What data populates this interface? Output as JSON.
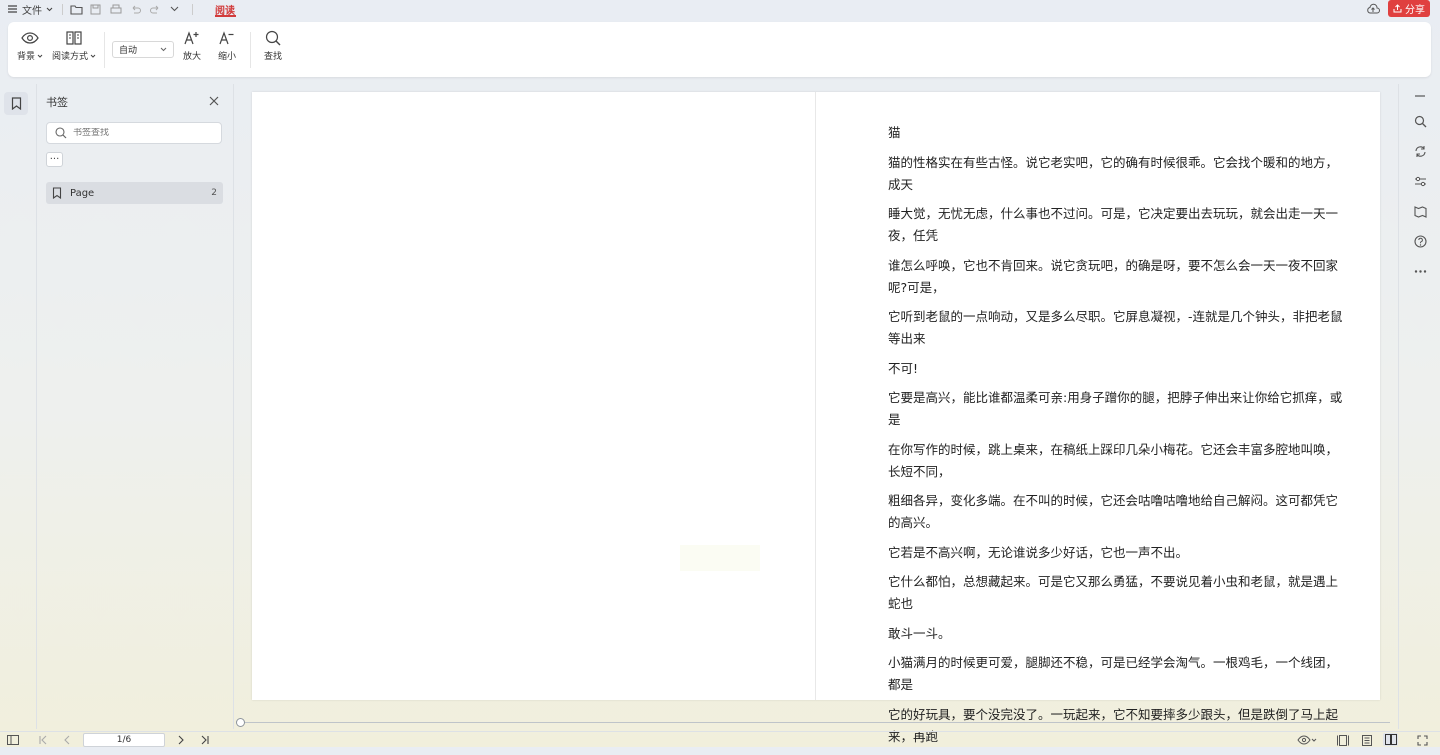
{
  "titlebar": {
    "menu_label": "文件",
    "active_tab": "阅读",
    "share_label": "分享"
  },
  "ribbon": {
    "background_label": "背景",
    "read_mode_label": "阅读方式",
    "zoom_value": "自动",
    "zoom_in_label": "放大",
    "zoom_out_label": "缩小",
    "find_label": "查找"
  },
  "bookmark_panel": {
    "title": "书签",
    "search_placeholder": "书签查找",
    "more_label": "···",
    "items": [
      {
        "label": "Page",
        "count": "2"
      }
    ]
  },
  "document": {
    "paragraphs": [
      "猫",
      "猫的性格实在有些古怪。说它老实吧，它的确有时候很乖。它会找个暖和的地方，成天",
      "睡大觉，无忧无虑，什么事也不过问。可是，它决定要出去玩玩，就会出走一天一夜，任凭",
      "谁怎么呼唤，它也不肯回来。说它贪玩吧，的确是呀，要不怎么会一天一夜不回家呢?可是，",
      "它听到老鼠的一点响动，又是多么尽职。它屏息凝视，-连就是几个钟头，非把老鼠等出来",
      "不可!",
      "它要是高兴，能比谁都温柔可亲:用身子蹭你的腿，把脖子伸出来让你给它抓痒，或是",
      "在你写作的时候，跳上桌来，在稿纸上踩印几朵小梅花。它还会丰富多腔地叫唤，长短不同，",
      "粗细各异，变化多端。在不叫的时候，它还会咕噜咕噜地给自己解闷。这可都凭它的高兴。",
      "它若是不高兴啊，无论谁说多少好话，它也一声不出。",
      "它什么都怕，总想藏起来。可是它又那么勇猛，不要说见着小虫和老鼠，就是遇上蛇也",
      "敢斗一斗。",
      "小猫满月的时候更可爱，腿脚还不稳，可是已经学会淘气。一根鸡毛，一个线团，都是",
      "它的好玩具，要个没完没了。一玩起来，它不知要摔多少跟头，但是跌倒了马上起来，再跑"
    ]
  },
  "statusbar": {
    "page_indicator": "1/6"
  },
  "colors": {
    "accent": "#d23b3b",
    "share_bg": "#e0403f"
  }
}
